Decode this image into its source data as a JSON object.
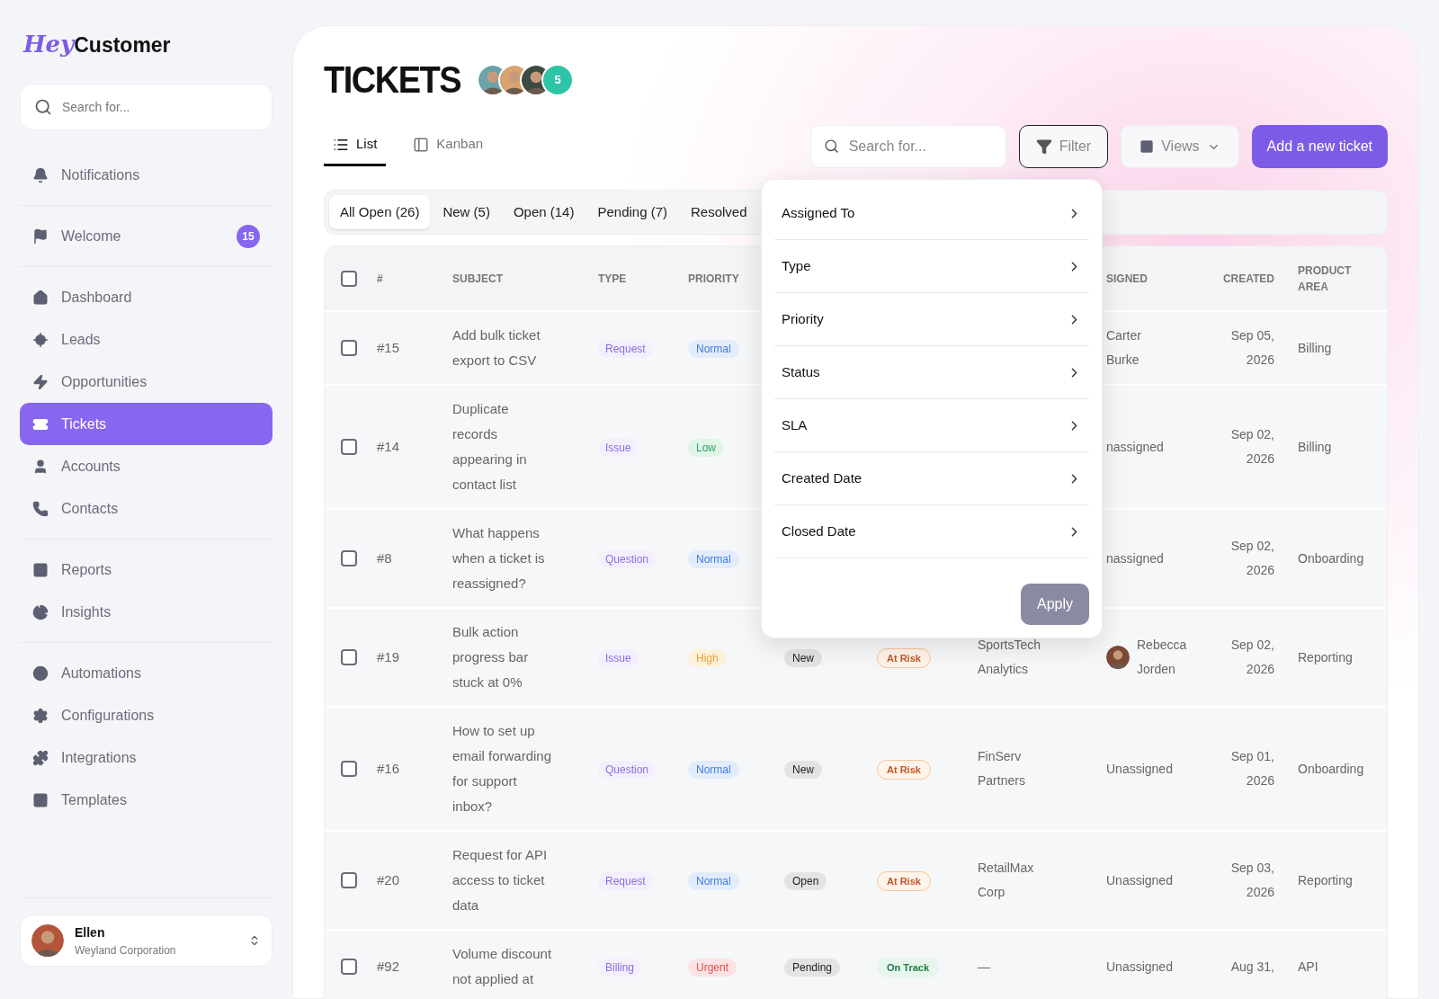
{
  "sidebar": {
    "logo": {
      "script": "Hey",
      "word": "Customer"
    },
    "search": {
      "placeholder": "Search for..."
    },
    "groups": [
      [
        {
          "label": "Notifications",
          "selected": false
        }
      ],
      [
        {
          "label": "Welcome",
          "selected": false,
          "badge": "15"
        }
      ],
      [
        {
          "label": "Dashboard",
          "selected": false
        },
        {
          "label": "Leads",
          "selected": false
        },
        {
          "label": "Opportunities",
          "selected": false
        },
        {
          "label": "Tickets",
          "selected": true
        },
        {
          "label": "Accounts",
          "selected": false
        },
        {
          "label": "Contacts",
          "selected": false
        }
      ],
      [
        {
          "label": "Reports",
          "selected": false
        },
        {
          "label": "Insights",
          "selected": false
        }
      ],
      [
        {
          "label": "Automations",
          "selected": false
        },
        {
          "label": "Configurations",
          "selected": false
        },
        {
          "label": "Integrations",
          "selected": false
        },
        {
          "label": "Templates",
          "selected": false
        }
      ]
    ],
    "user": {
      "name": "Ellen",
      "company": "Weyland Corporation"
    }
  },
  "header": {
    "title": "TICKETS",
    "more_count": "5"
  },
  "view_tabs": [
    {
      "label": "List",
      "selected": true
    },
    {
      "label": "Kanban",
      "selected": false
    }
  ],
  "search": {
    "placeholder": "Search for..."
  },
  "filter": {
    "label": "Filter",
    "open": true,
    "menu": [
      "Assigned To",
      "Type",
      "Priority",
      "Status",
      "SLA",
      "Created Date",
      "Closed Date"
    ],
    "apply": "Apply"
  },
  "views": {
    "label": "Views"
  },
  "add_button": "Add a new ticket",
  "status_tabs": [
    {
      "label": "All Open (26)",
      "selected": true
    },
    {
      "label": "New (5)",
      "selected": false
    },
    {
      "label": "Open (14)",
      "selected": false
    },
    {
      "label": "Pending (7)",
      "selected": false
    },
    {
      "label": "Resolved",
      "selected": false
    }
  ],
  "table": {
    "all_checked": false,
    "columns": [
      "#",
      "SUBJECT",
      "TYPE",
      "PRIORITY",
      null,
      null,
      null,
      "SIGNED",
      "CREATED",
      "PRODUCT AREA"
    ],
    "rows": [
      {
        "checked": false,
        "id": "#15",
        "subject": "Add bulk ticket export to CSV",
        "type": "Request",
        "priority": {
          "text": "Normal",
          "kind": "normal"
        },
        "assignee": {
          "name": "Carter Burke",
          "avatar": false
        },
        "created": "Sep 05, 2026",
        "area": "Billing"
      },
      {
        "checked": false,
        "id": "#14",
        "subject": "Duplicate records appearing in contact list",
        "type": "Issue",
        "priority": {
          "text": "Low",
          "kind": "low"
        },
        "assignee": {
          "name": "nassigned",
          "avatar": false
        },
        "created": "Sep 02, 2026",
        "area": "Billing"
      },
      {
        "checked": false,
        "id": "#8",
        "subject": "What happens when a ticket is reassigned?",
        "type": "Question",
        "priority": {
          "text": "Normal",
          "kind": "normal"
        },
        "assignee": {
          "name": "nassigned",
          "avatar": false
        },
        "created": "Sep 02, 2026",
        "area": "Onboarding"
      },
      {
        "checked": false,
        "id": "#19",
        "subject": "Bulk action progress bar stuck at 0%",
        "type": "Issue",
        "priority": {
          "text": "High",
          "kind": "high"
        },
        "status": "New",
        "sla": {
          "text": "At Risk",
          "kind": "risk"
        },
        "account": "SportsTech Analytics",
        "assignee": {
          "name": "Rebecca Jorden",
          "avatar": true
        },
        "created": "Sep 02, 2026",
        "area": "Reporting"
      },
      {
        "checked": false,
        "id": "#16",
        "subject": "How to set up email forwarding for support inbox?",
        "type": "Question",
        "priority": {
          "text": "Normal",
          "kind": "normal"
        },
        "status": "New",
        "sla": {
          "text": "At Risk",
          "kind": "risk"
        },
        "account": "FinServ Partners",
        "assignee": {
          "name": "Unassigned",
          "avatar": false
        },
        "created": "Sep 01, 2026",
        "area": "Onboarding"
      },
      {
        "checked": false,
        "id": "#20",
        "subject": "Request for API access to ticket data",
        "type": "Request",
        "priority": {
          "text": "Normal",
          "kind": "normal"
        },
        "status": "Open",
        "sla": {
          "text": "At Risk",
          "kind": "risk"
        },
        "account": "RetailMax Corp",
        "assignee": {
          "name": "Unassigned",
          "avatar": false
        },
        "created": "Sep 03, 2026",
        "area": "Reporting"
      },
      {
        "checked": false,
        "id": "#92",
        "subject": "Volume discount not applied at",
        "type": "Billing",
        "priority": {
          "text": "Urgent",
          "kind": "urgent"
        },
        "status": "Pending",
        "sla": {
          "text": "On Track",
          "kind": "ok"
        },
        "account": "—",
        "assignee": {
          "name": "Unassigned",
          "avatar": false
        },
        "created": "Aug 31,",
        "area": "API"
      }
    ]
  }
}
